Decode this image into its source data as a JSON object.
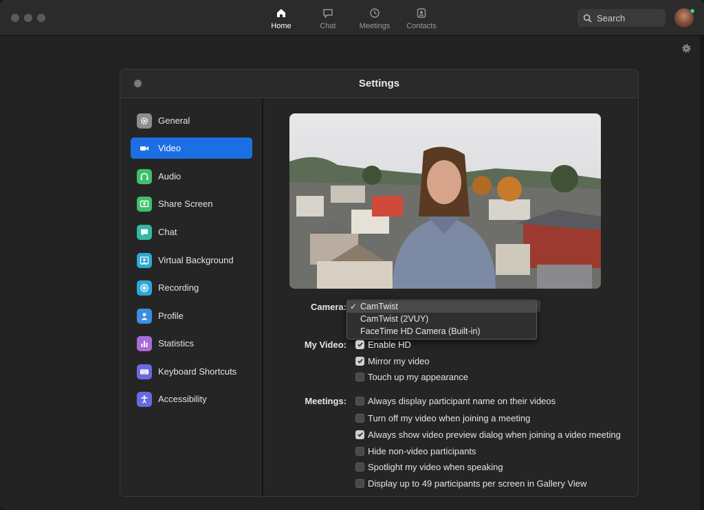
{
  "topnav": {
    "items": [
      {
        "label": "Home",
        "icon": "home-icon",
        "active": true
      },
      {
        "label": "Chat",
        "icon": "chat-bubble-icon",
        "active": false
      },
      {
        "label": "Meetings",
        "icon": "clock-icon",
        "active": false
      },
      {
        "label": "Contacts",
        "icon": "contact-card-icon",
        "active": false
      }
    ],
    "search_placeholder": "Search"
  },
  "settings": {
    "title": "Settings",
    "sidebar": [
      {
        "label": "General",
        "icon": "gear-icon",
        "color": "#8e8e8e"
      },
      {
        "label": "Video",
        "icon": "video-camera-icon",
        "color": "#1b6fe3",
        "active": true
      },
      {
        "label": "Audio",
        "icon": "headphones-icon",
        "color": "#3fbf6a"
      },
      {
        "label": "Share Screen",
        "icon": "share-screen-icon",
        "color": "#3fbf6a"
      },
      {
        "label": "Chat",
        "icon": "chat-bubble-icon",
        "color": "#36b8a0"
      },
      {
        "label": "Virtual Background",
        "icon": "virtual-background-icon",
        "color": "#2fa8d8"
      },
      {
        "label": "Recording",
        "icon": "record-icon",
        "color": "#2fa8d8"
      },
      {
        "label": "Profile",
        "icon": "person-icon",
        "color": "#3a8fe0"
      },
      {
        "label": "Statistics",
        "icon": "bar-chart-icon",
        "color": "#a86ad8"
      },
      {
        "label": "Keyboard Shortcuts",
        "icon": "keyboard-icon",
        "color": "#6a6ae0"
      },
      {
        "label": "Accessibility",
        "icon": "accessibility-icon",
        "color": "#6a6ae0"
      }
    ],
    "video": {
      "camera_label": "Camera:",
      "camera_options": [
        {
          "label": "CamTwist",
          "selected": true
        },
        {
          "label": "CamTwist (2VUY)",
          "selected": false
        },
        {
          "label": "FaceTime HD Camera (Built-in)",
          "selected": false
        }
      ],
      "my_video_label": "My Video:",
      "my_video_options": [
        {
          "label": "Enable HD",
          "checked": true
        },
        {
          "label": "Mirror my video",
          "checked": true
        },
        {
          "label": "Touch up my appearance",
          "checked": false
        }
      ],
      "meetings_label": "Meetings:",
      "meetings_options": [
        {
          "label": "Always display participant name on their videos",
          "checked": false
        },
        {
          "label": "Turn off my video when joining a meeting",
          "checked": false
        },
        {
          "label": "Always show video preview dialog when joining a video meeting",
          "checked": true
        },
        {
          "label": "Hide non-video participants",
          "checked": false
        },
        {
          "label": "Spotlight my video when speaking",
          "checked": false
        },
        {
          "label": "Display up to 49 participants per screen in Gallery View",
          "checked": false
        }
      ]
    }
  }
}
